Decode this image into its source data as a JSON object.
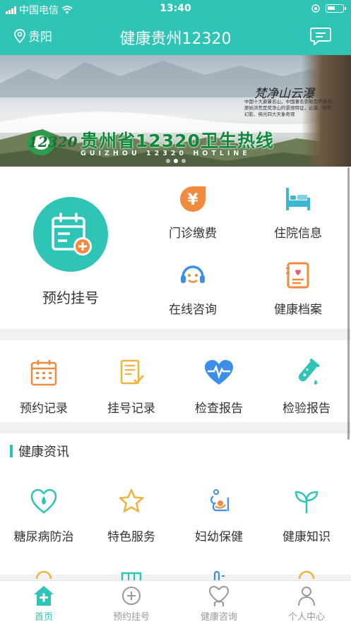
{
  "status": {
    "carrier": "中国电信",
    "time": "13:40"
  },
  "header": {
    "location": "贵阳",
    "title": "健康贵州12320"
  },
  "banner": {
    "caption": "梵净山云瀑",
    "description": "中国十大避暑名山，中国著名弥勒菩萨道场，原始洪荒是梵净山的景观特征，云瀑、禅雾、幻影、佛光四大天象奇观",
    "hotline": "贵州省12320卫生热线",
    "hotline_en": "GUIZHOU 12320 HOTLINE",
    "logo_text": "12320"
  },
  "quick": {
    "main_label": "预约挂号",
    "items": [
      {
        "label": "门诊缴费",
        "icon": "yen-icon"
      },
      {
        "label": "住院信息",
        "icon": "bed-icon"
      },
      {
        "label": "在线咨询",
        "icon": "headset-icon"
      },
      {
        "label": "健康档案",
        "icon": "health-record-icon"
      }
    ]
  },
  "records": [
    {
      "label": "预约记录",
      "icon": "calendar-icon"
    },
    {
      "label": "挂号记录",
      "icon": "checklist-icon"
    },
    {
      "label": "检查报告",
      "icon": "heartbeat-icon"
    },
    {
      "label": "检验报告",
      "icon": "test-tube-icon"
    }
  ],
  "health": {
    "title": "健康资讯",
    "items": [
      {
        "label": "糖尿病防治",
        "icon": "drop-heart-icon"
      },
      {
        "label": "特色服务",
        "icon": "star-icon"
      },
      {
        "label": "妇幼保健",
        "icon": "mother-child-icon"
      },
      {
        "label": "健康知识",
        "icon": "sprout-icon"
      }
    ]
  },
  "tabs": [
    {
      "label": "首页",
      "icon": "home-icon",
      "active": true
    },
    {
      "label": "预约挂号",
      "icon": "plus-circle-icon",
      "active": false
    },
    {
      "label": "健康咨询",
      "icon": "heart-chat-icon",
      "active": false
    },
    {
      "label": "个人中心",
      "icon": "user-icon",
      "active": false
    }
  ],
  "colors": {
    "primary": "#2ec5b6",
    "orange": "#f08a3c",
    "blue": "#3d8ee8",
    "tab_inactive": "#999999"
  }
}
